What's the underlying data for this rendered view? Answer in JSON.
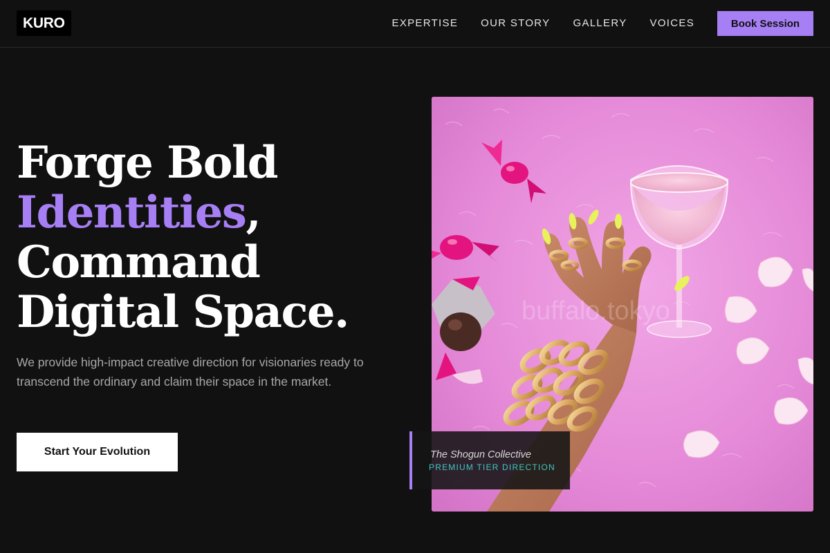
{
  "brand": {
    "logo_text": "KURO",
    "accent_color": "#a77ff5",
    "background_color": "#111111",
    "caption_accent_color": "#3ec9c1"
  },
  "nav": {
    "items": [
      {
        "label": "EXPERTISE"
      },
      {
        "label": "OUR STORY"
      },
      {
        "label": "GALLERY"
      },
      {
        "label": "VOICES"
      }
    ],
    "cta_label": "Book Session"
  },
  "hero": {
    "headline_line1": "Forge Bold",
    "headline_accent": "Identities",
    "headline_comma": ",",
    "headline_line3": "Command",
    "headline_line4": "Digital Space.",
    "subtext": "We provide high-impact creative direction for visionaries ready to transcend the ordinary and claim their space in the market.",
    "cta_label": "Start Your Evolution"
  },
  "feature_image": {
    "subject": "hand-with-gold-chains-and-cocktail-on-pink-fur",
    "watermark": "buffalo.tokyo"
  },
  "caption": {
    "title": "The Shogun Collective",
    "subtitle": "PREMIUM TIER DIRECTION"
  }
}
